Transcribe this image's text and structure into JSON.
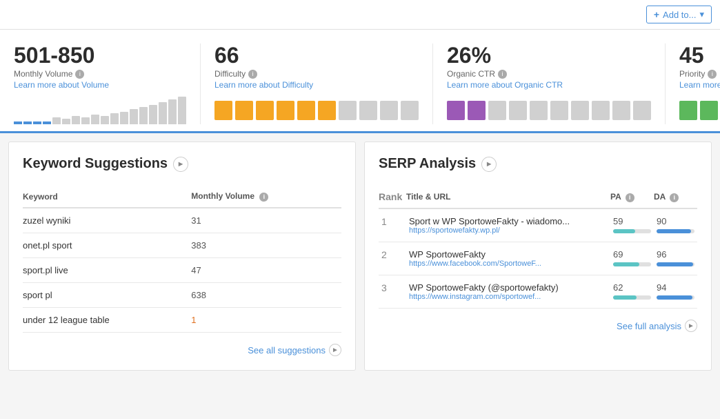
{
  "header": {
    "add_to_label": "Add to...",
    "plus_symbol": "+"
  },
  "metrics": {
    "volume": {
      "value": "501-850",
      "label": "Monthly Volume",
      "link_text": "Learn more about Volume"
    },
    "difficulty": {
      "value": "66",
      "label": "Difficulty",
      "link_text": "Learn more about Difficulty"
    },
    "ctr": {
      "value": "26%",
      "label": "Organic CTR",
      "link_text": "Learn more about Organic CTR"
    },
    "priority": {
      "value": "45",
      "label": "Priority",
      "link_text": "Learn more about Priority"
    }
  },
  "keyword_suggestions": {
    "title": "Keyword Suggestions",
    "col_keyword": "Keyword",
    "col_volume": "Monthly Volume",
    "rows": [
      {
        "keyword": "zuzel wyniki",
        "volume": "31",
        "low": false
      },
      {
        "keyword": "onet.pl sport",
        "volume": "383",
        "low": false
      },
      {
        "keyword": "sport.pl live",
        "volume": "47",
        "low": false
      },
      {
        "keyword": "sport pl",
        "volume": "638",
        "low": false
      },
      {
        "keyword": "under 12 league table",
        "volume": "1",
        "low": true
      }
    ],
    "see_all_label": "See all suggestions"
  },
  "serp_analysis": {
    "title": "SERP Analysis",
    "col_rank": "Rank",
    "col_title": "Title & URL",
    "col_pa": "PA",
    "col_da": "DA",
    "rows": [
      {
        "rank": "1",
        "title": "Sport w WP SportoweFakty - wiadomo...",
        "url": "https://sportowefakty.wp.pl/",
        "pa": 59,
        "da": 90
      },
      {
        "rank": "2",
        "title": "WP SportoweFakty",
        "url": "https://www.facebook.com/SportoweF...",
        "pa": 69,
        "da": 96
      },
      {
        "rank": "3",
        "title": "WP SportoweFakty (@sportowefakty)",
        "url": "https://www.instagram.com/sportowef...",
        "pa": 62,
        "da": 94
      }
    ],
    "see_full_label": "See full analysis"
  },
  "colors": {
    "accent_blue": "#4a90d9",
    "gold": "#f5a623",
    "purple": "#9b59b6",
    "green": "#5cb85c",
    "light_gray": "#d0d0d0",
    "pa_color": "#5bc4c4",
    "da_color": "#4a90d9"
  }
}
